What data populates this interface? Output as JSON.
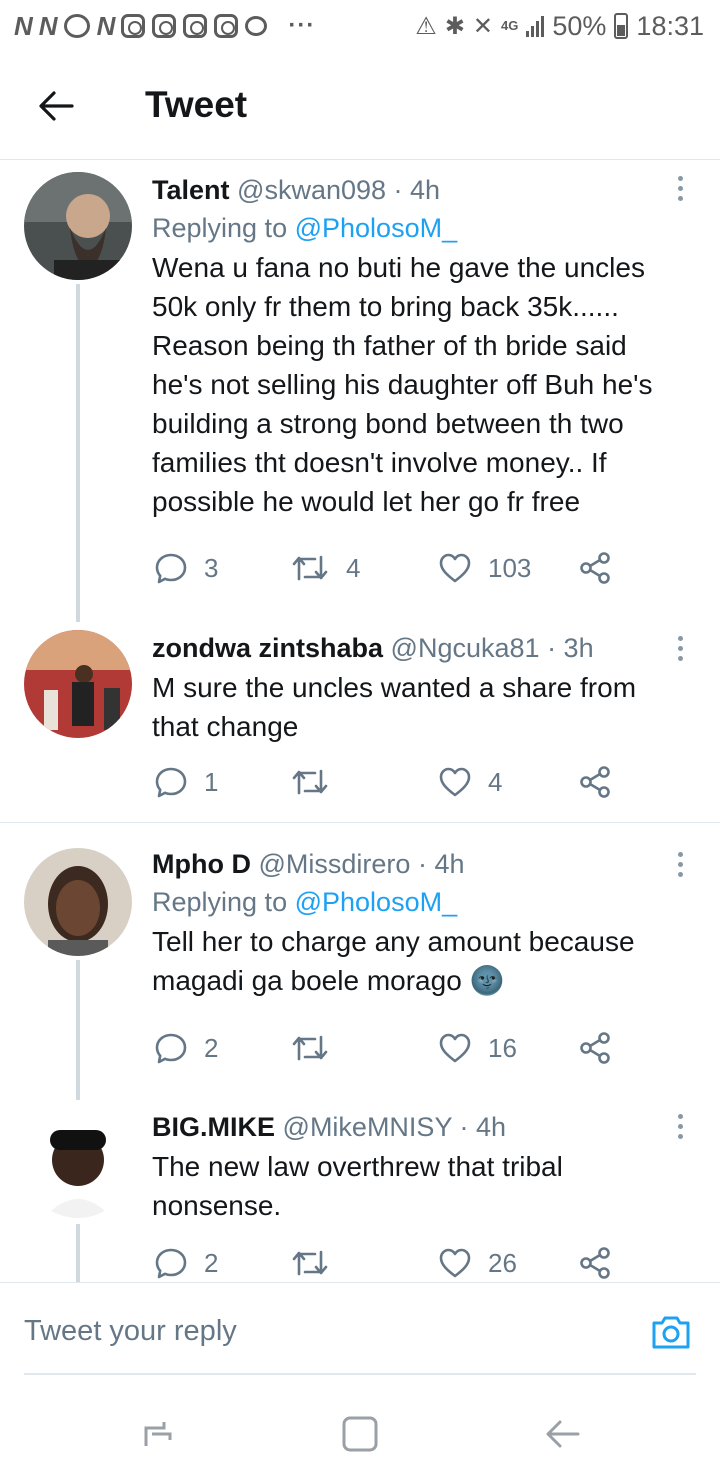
{
  "status_bar": {
    "network_type": "4G",
    "battery": "50%",
    "time": "18:31"
  },
  "header": {
    "title": "Tweet",
    "back_icon": "arrow-left-icon"
  },
  "replies": [
    {
      "name": "Talent",
      "handle": "@skwan098",
      "time": "· 4h",
      "replying_label": "Replying to",
      "replying_to": "@PholosoM_",
      "text": "Wena u fana no buti he gave the uncles 50k only fr them to bring back 35k...... Reason being th father of th bride said he's not selling his daughter off Buh he's building a strong bond between th two families tht doesn't involve money.. If possible he would let her go fr free",
      "reply_count": "3",
      "retweet_count": "4",
      "like_count": "103"
    },
    {
      "name": "zondwa zintshaba",
      "handle": "@Ngcuka81",
      "time": "· 3h",
      "text": "M sure the uncles wanted a share from that change",
      "reply_count": "1",
      "retweet_count": "",
      "like_count": "4"
    },
    {
      "name": "Mpho D",
      "handle": "@Missdirero",
      "time": "· 4h",
      "replying_label": "Replying to",
      "replying_to": "@PholosoM_",
      "text": "Tell her to charge any amount because magadi ga boele morago 🌚",
      "reply_count": "2",
      "retweet_count": "",
      "like_count": "16"
    },
    {
      "name": "BIG.MIKE",
      "handle": "@MikeMNISY",
      "time": "· 4h",
      "text": "The new law overthrew that tribal nonsense.",
      "reply_count": "2",
      "retweet_count": "",
      "like_count": "26"
    }
  ],
  "compose": {
    "placeholder": "Tweet your reply",
    "camera_icon": "camera-icon"
  },
  "colors": {
    "accent": "#1da1f2",
    "secondary_text": "#657786",
    "primary_text": "#14171a",
    "divider": "#e1e8ed"
  }
}
